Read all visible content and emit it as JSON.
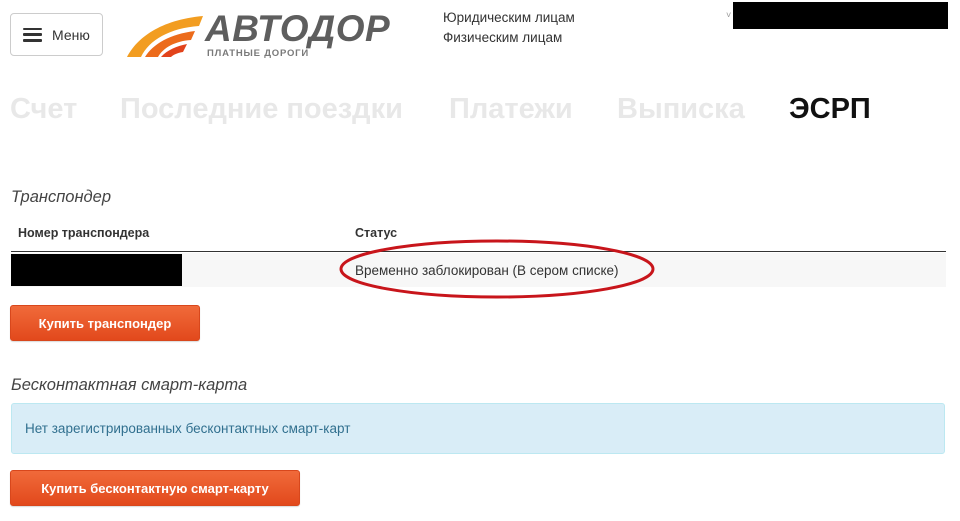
{
  "header": {
    "menu_label": "Меню",
    "logo_text": "АВТОДОР",
    "logo_subtitle": "ПЛАТНЫЕ ДОРОГИ",
    "links": [
      "Юридическим лицам",
      "Физическим лицам"
    ],
    "caret": "˅"
  },
  "tabs": [
    {
      "label": "Счет",
      "active": false
    },
    {
      "label": "Последние поездки",
      "active": false
    },
    {
      "label": "Платежи",
      "active": false
    },
    {
      "label": "Выписка",
      "active": false
    },
    {
      "label": "ЭСРП",
      "active": true
    }
  ],
  "transponder": {
    "title": "Транспондер",
    "columns": [
      "Номер транспондера",
      "Статус"
    ],
    "rows": [
      {
        "status": "Временно заблокирован (В сером списке)"
      }
    ],
    "buy_button": "Купить транспондер"
  },
  "smartcard": {
    "title": "Бесконтактная смарт-карта",
    "empty_message": "Нет зарегистрированных бесконтактных смарт-карт",
    "buy_button": "Купить бесконтактную смарт-карту"
  },
  "colors": {
    "accent_orange": "#e8501f",
    "annotation_red": "#c8151b",
    "info_bg": "#d9edf7",
    "info_text": "#31708f"
  }
}
